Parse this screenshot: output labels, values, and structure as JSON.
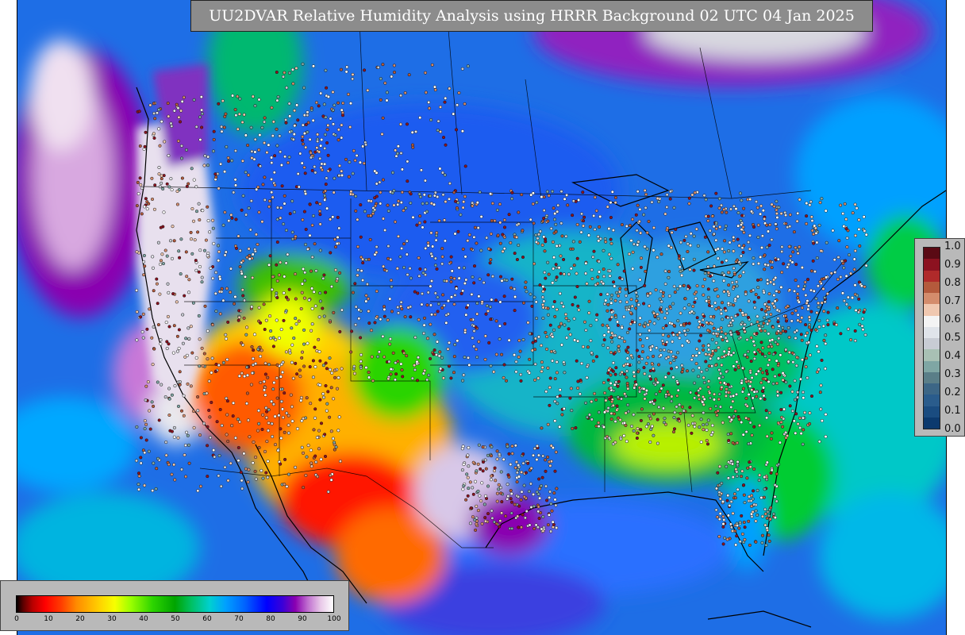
{
  "title": "UU2DVAR Relative Humidity Analysis using HRRR Background 02 UTC 04 Jan 2025",
  "colorbars": {
    "rh_scale": {
      "ticks": [
        "0",
        "10",
        "20",
        "30",
        "40",
        "50",
        "60",
        "70",
        "80",
        "90",
        "100"
      ],
      "colors": [
        "#000000",
        "#b80000",
        "#ff3c00",
        "#ffd000",
        "#9cff00",
        "#00a400",
        "#00d0d0",
        "#0064ff",
        "#3a00d8",
        "#c070d0",
        "#ffffff"
      ]
    },
    "ob_scale": {
      "ticks": [
        "1.0",
        "0.9",
        "0.8",
        "0.7",
        "0.6",
        "0.5",
        "0.4",
        "0.3",
        "0.2",
        "0.1",
        "0.0"
      ],
      "colors": [
        "#5a0a14",
        "#8c1220",
        "#b02a2a",
        "#b45a3c",
        "#d48c6c",
        "#f0c8b0",
        "#f4f4f4",
        "#e0e4ea",
        "#c8ccd4",
        "#a8c0b4",
        "#7fa6a4",
        "#5a7e88",
        "#3c6686",
        "#2a5c8c",
        "#1a4c80",
        "#0c3a6e"
      ]
    }
  }
}
